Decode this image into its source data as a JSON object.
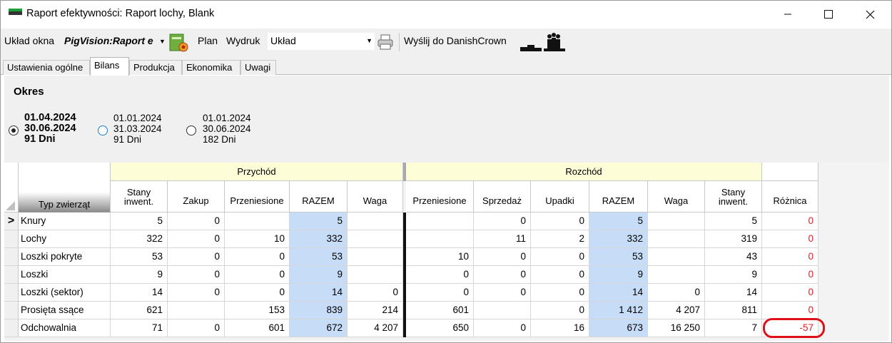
{
  "window": {
    "title": "Raport efektywności: Raport lochy, Blank",
    "controls": [
      "minimize",
      "maximize",
      "close"
    ]
  },
  "toolbar": {
    "layout_label": "Układ okna",
    "layout_value": "PigVision:Raport e",
    "plan_label": "Plan",
    "print_label": "Wydruk",
    "uklad_combo_value": "Układ",
    "send_label": "Wyślij do DanishCrown"
  },
  "tabs": [
    {
      "label": "Ustawienia ogólne",
      "active": false
    },
    {
      "label": "Bilans",
      "active": true
    },
    {
      "label": "Produkcja",
      "active": false
    },
    {
      "label": "Ekonomika",
      "active": false
    },
    {
      "label": "Uwagi",
      "active": false
    }
  ],
  "period": {
    "title": "Okres",
    "options": [
      {
        "from": "01.04.2024",
        "to": "30.06.2024",
        "days": "91 Dni",
        "selected": true
      },
      {
        "from": "01.01.2024",
        "to": "31.03.2024",
        "days": "91 Dni",
        "selected": false
      },
      {
        "from": "01.01.2024",
        "to": "30.06.2024",
        "days": "182 Dni",
        "selected": false
      }
    ]
  },
  "grid": {
    "groups": {
      "income": "Przychód",
      "outgo": "Rozchód"
    },
    "type_header": "Typ zwierząt",
    "columns": [
      "Stany\ninwent.",
      "Zakup",
      "Przeniesione",
      "RAZEM",
      "Waga",
      "Przeniesione",
      "Sprzedaż",
      "Upadki",
      "RAZEM",
      "Waga",
      "Stany\ninwent.",
      "Różnica"
    ],
    "current_row_marker": ">",
    "rows": [
      {
        "name": "Knury",
        "cells": [
          "5",
          "0",
          "",
          "5",
          "",
          "",
          "0",
          "0",
          "5",
          "",
          "5",
          "0"
        ]
      },
      {
        "name": "Lochy",
        "cells": [
          "322",
          "0",
          "10",
          "332",
          "",
          "",
          "11",
          "2",
          "332",
          "",
          "319",
          "0"
        ]
      },
      {
        "name": "Loszki pokryte",
        "cells": [
          "53",
          "0",
          "0",
          "53",
          "",
          "10",
          "0",
          "0",
          "53",
          "",
          "43",
          "0"
        ]
      },
      {
        "name": "Loszki",
        "cells": [
          "9",
          "0",
          "0",
          "9",
          "",
          "0",
          "0",
          "0",
          "9",
          "",
          "9",
          "0"
        ]
      },
      {
        "name": "Loszki (sektor)",
        "cells": [
          "14",
          "0",
          "0",
          "14",
          "0",
          "0",
          "0",
          "0",
          "14",
          "0",
          "14",
          "0"
        ]
      },
      {
        "name": "Prosięta ssące",
        "cells": [
          "621",
          "",
          "153",
          "839",
          "214",
          "601",
          "",
          "0",
          "1 412",
          "4 207",
          "811",
          "0"
        ]
      },
      {
        "name": "Odchowalnia",
        "cells": [
          "71",
          "0",
          "601",
          "672",
          "4 207",
          "650",
          "0",
          "16",
          "673",
          "16 250",
          "7",
          "-57"
        ]
      }
    ],
    "highlighted_cell": "Odchowalnia / Różnica"
  },
  "colors": {
    "group_header_bg": "#fdfdd8",
    "razem_bg": "#c7dcf7",
    "diff_text": "#e0202a",
    "highlight": "#e0101a"
  }
}
